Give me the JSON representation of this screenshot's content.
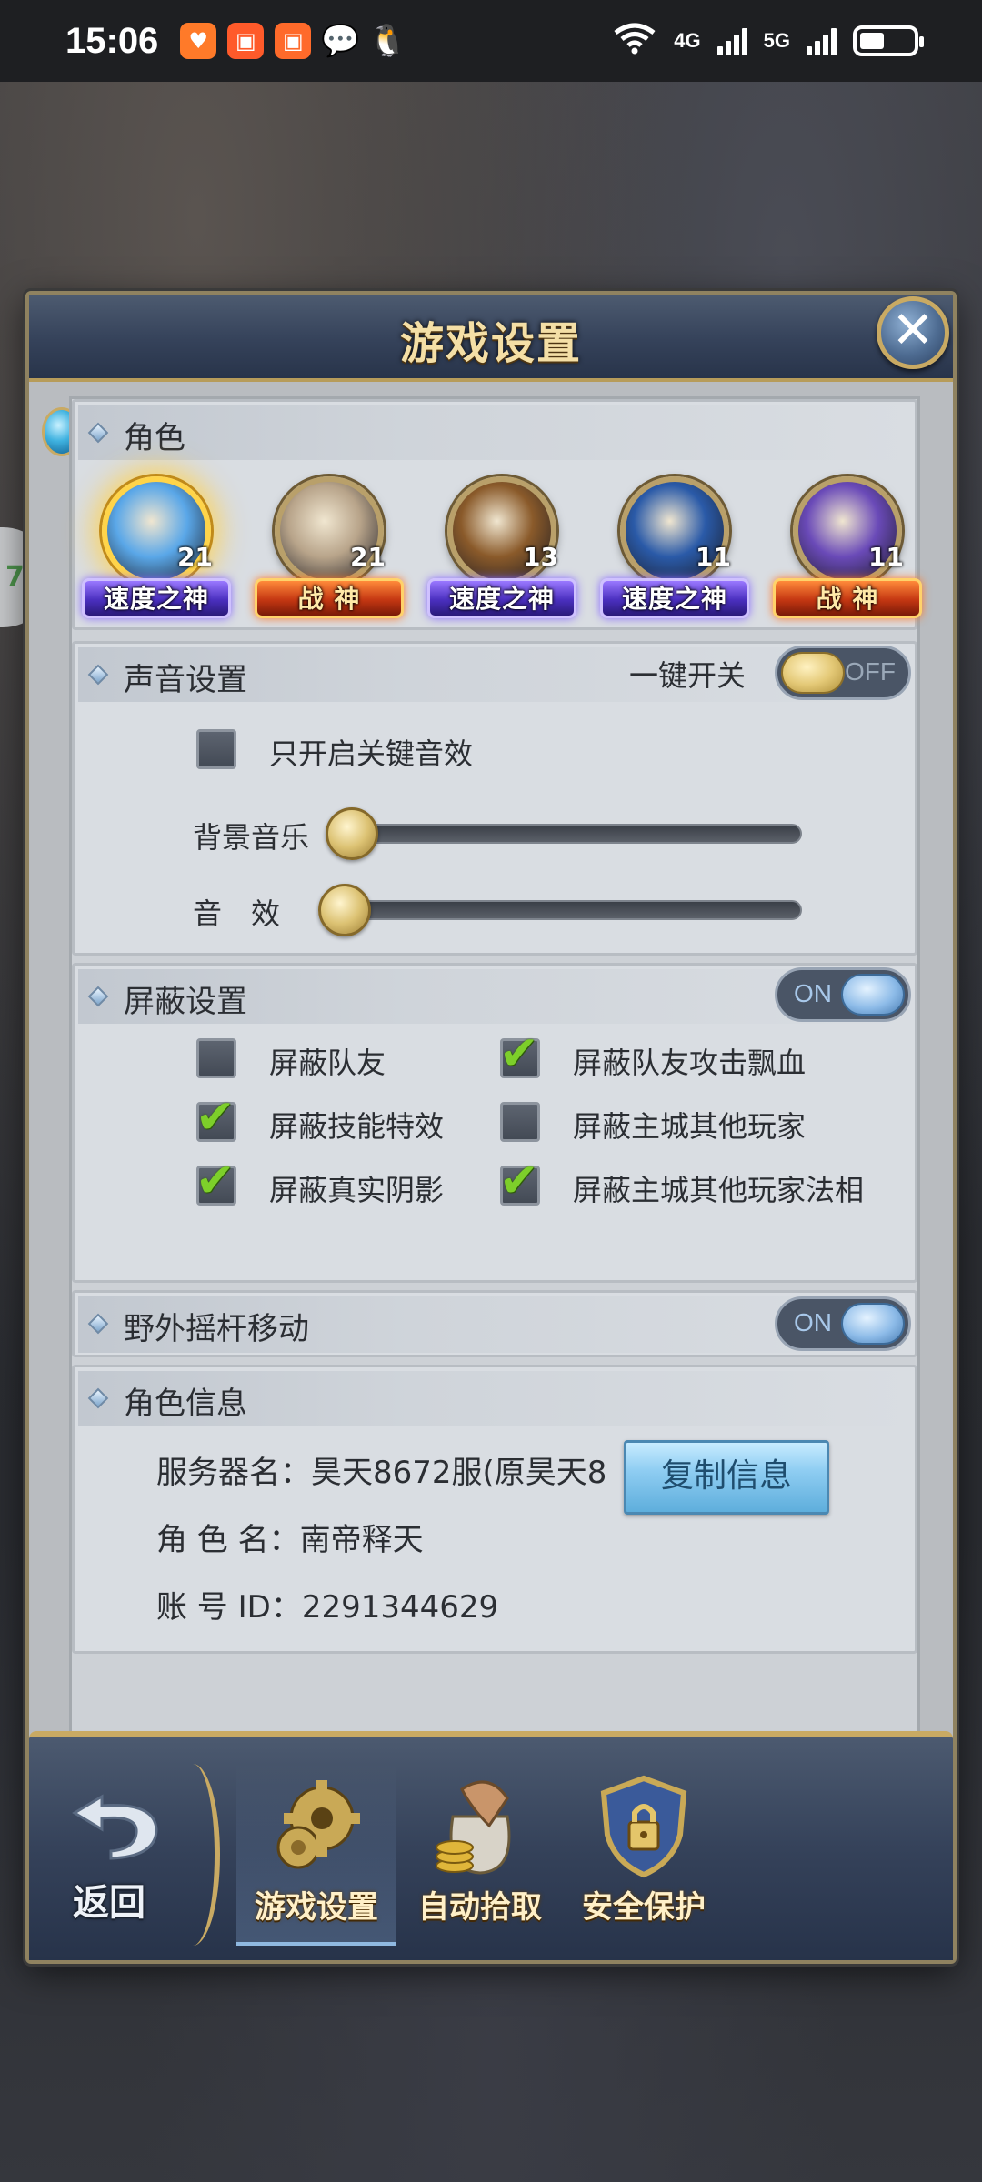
{
  "status_bar": {
    "time": "15:06",
    "network_wifi": "6",
    "network_4g": "4G",
    "network_5g": "5G",
    "app_icons": [
      "taobao-icon",
      "kuaishou-icon",
      "kuaishou-lite-icon",
      "wechat-icon",
      "qq-icon"
    ]
  },
  "dialog": {
    "title": "游戏设置"
  },
  "role_section": {
    "title": "角色",
    "heroes": [
      {
        "level": "21",
        "badge": "速度之神",
        "badge_type": "speed",
        "active": true,
        "color": "#5aa7e8"
      },
      {
        "level": "21",
        "badge": "战 神",
        "badge_type": "war",
        "active": false,
        "color": "#b8a48a"
      },
      {
        "level": "13",
        "badge": "速度之神",
        "badge_type": "speed",
        "active": false,
        "color": "#8a5a2a"
      },
      {
        "level": "11",
        "badge": "速度之神",
        "badge_type": "speed",
        "active": false,
        "color": "#2a5aa8"
      },
      {
        "level": "11",
        "badge": "战 神",
        "badge_type": "war",
        "active": false,
        "color": "#6a4ab8"
      }
    ]
  },
  "sound_section": {
    "title": "声音设置",
    "master_label": "一键开关",
    "master_toggle": "OFF",
    "key_only_label": "只开启关键音效",
    "key_only_checked": false,
    "bgm_label": "背景音乐",
    "bgm_value": 0,
    "sfx_label": "音　效",
    "sfx_value": 0
  },
  "block_section": {
    "title": "屏蔽设置",
    "toggle": "ON",
    "options": [
      {
        "label": "屏蔽队友",
        "checked": false
      },
      {
        "label": "屏蔽队友攻击飘血",
        "checked": true
      },
      {
        "label": "屏蔽技能特效",
        "checked": true
      },
      {
        "label": "屏蔽主城其他玩家",
        "checked": false
      },
      {
        "label": "屏蔽真实阴影",
        "checked": true
      },
      {
        "label": "屏蔽主城其他玩家法相",
        "checked": true
      }
    ]
  },
  "joystick_section": {
    "title": "野外摇杆移动",
    "toggle": "ON"
  },
  "info_section": {
    "title": "角色信息",
    "server_label": "服务器名：",
    "server_value": "昊天8672服(原昊天8",
    "role_label": "角 色 名：",
    "role_value": "南帝释天",
    "account_label": "账 号 ID：",
    "account_value": "2291344629",
    "copy_button": "复制信息"
  },
  "bottom_nav": {
    "back_label": "返回",
    "items": [
      {
        "label": "游戏设置",
        "icon": "gear-icon",
        "active": true
      },
      {
        "label": "自动拾取",
        "icon": "loot-bag-icon",
        "active": false
      },
      {
        "label": "安全保护",
        "icon": "shield-lock-icon",
        "active": false
      }
    ]
  },
  "colors": {
    "title_gold": "#f4dfa6",
    "header_blue": "#35425a",
    "check_green": "#7dcf2a"
  }
}
